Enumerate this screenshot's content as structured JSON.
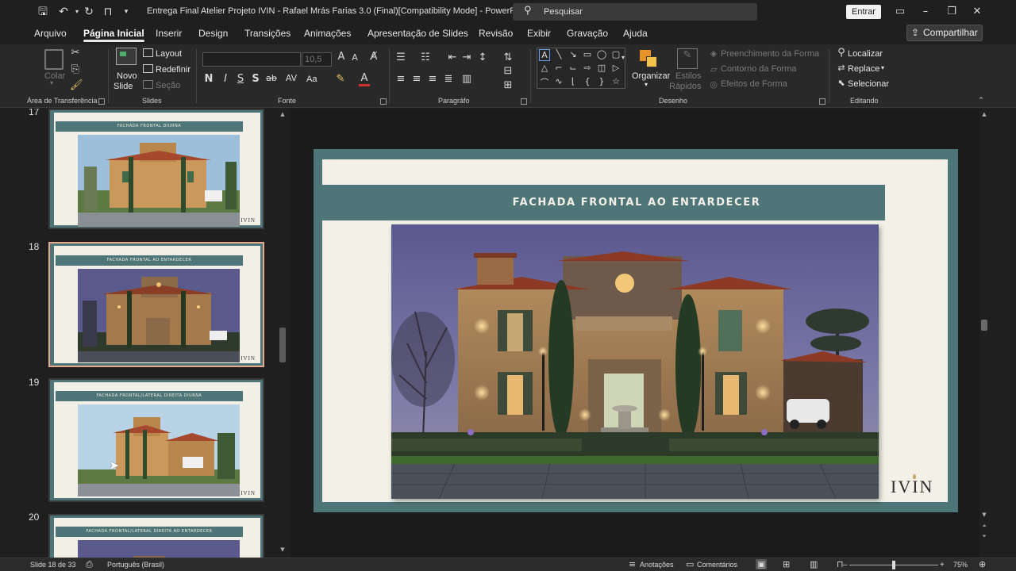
{
  "titlebar": {
    "doc_title": "Entrega Final Atelier Projeto IVIN - Rafael Mrás Farias 3.0 (Final)[Compatibility Mode]  -  PowerPoint",
    "search_placeholder": "Pesquisar",
    "signin_label": "Entrar"
  },
  "tabs": [
    "Arquivo",
    "Página Inicial",
    "Inserir",
    "Design",
    "Transições",
    "Animações",
    "Apresentação de Slides",
    "Revisão",
    "Exibir",
    "Gravação",
    "Ajuda"
  ],
  "active_tab": "Página Inicial",
  "share_label": "Compartilhar",
  "ribbon": {
    "clipboard": {
      "paste": "Colar",
      "group": "Área de Transferência"
    },
    "slides": {
      "new_slide_1": "Novo",
      "new_slide_2": "Slide",
      "layout": "Layout",
      "reset": "Redefinir",
      "section": "Seção",
      "group": "Slides"
    },
    "font": {
      "size": "10,5",
      "change_case": "Aa",
      "group": "Fonte"
    },
    "paragraph": {
      "group": "Paragráfo"
    },
    "drawing": {
      "arrange": "Organizar",
      "quick_styles_1": "Estilos",
      "quick_styles_2": "Rápidos",
      "shape_fill": "Preenchimento da Forma",
      "shape_outline": "Contorno da Forma",
      "shape_effects": "Efeitos de Forma",
      "group": "Desenho"
    },
    "editing": {
      "find": "Localizar",
      "replace": "Replace",
      "select": "Selecionar",
      "group": "Editando"
    }
  },
  "thumbnails": [
    {
      "number": "17",
      "title": "FACHADA FRONTAL DIURNA",
      "variant": "day",
      "logo": "IVIN"
    },
    {
      "number": "18",
      "title": "FACHADA FRONTAL AO ENTARDECER",
      "variant": "dusk",
      "logo": "IVIN"
    },
    {
      "number": "19",
      "title": "FACHADA FRONTAL/LATERAL DIREITA DIURNA",
      "variant": "day-side",
      "logo": "IVIN"
    },
    {
      "number": "20",
      "title": "FACHADA FRONTAL/LATERAL DIREITA AO ENTARDECER",
      "variant": "dusk-side",
      "logo": ""
    }
  ],
  "slide": {
    "title": "FACHADA FRONTAL AO ENTARDECER",
    "logo": "IVIN"
  },
  "status": {
    "slide_count": "Slide 18 de 33",
    "language": "Português (Brasil)",
    "notes": "Anotações",
    "comments": "Comentários",
    "zoom": "75%"
  },
  "colors": {
    "teal": "#4e7577",
    "cream": "#f3f1e7",
    "selected_border": "#e8a88c"
  }
}
